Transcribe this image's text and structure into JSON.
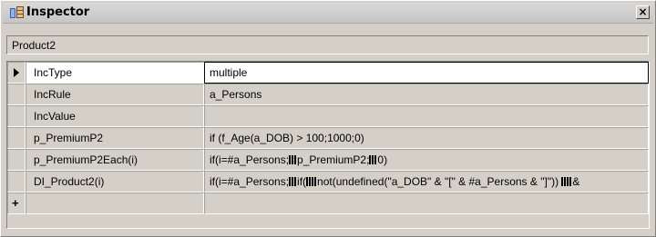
{
  "window": {
    "title": "Inspector",
    "close_symbol": "×"
  },
  "object_name": "Product2",
  "properties": [
    {
      "name": "IncType",
      "value": "multiple"
    },
    {
      "name": "IncRule",
      "value": "a_Persons"
    },
    {
      "name": "IncValue",
      "value": ""
    },
    {
      "name": "p_PremiumP2",
      "value": "if (f_Age(a_DOB) > 100;1000;0)"
    },
    {
      "name": "p_PremiumP2Each(i)",
      "value_parts": [
        "if(i=#a_Persons;",
        "p_PremiumP2;",
        "0)"
      ]
    },
    {
      "name": "DI_Product2(i)",
      "value_parts": [
        "if(i=#a_Persons;",
        "if(",
        "not(undefined(\"a_DOB\" & \"[\" & #a_Persons & \"]\"))  ",
        "&"
      ]
    }
  ],
  "new_row_symbol": "+",
  "icons": {
    "app": "inspector-app-icon",
    "current_row": "row-pointer-icon"
  }
}
